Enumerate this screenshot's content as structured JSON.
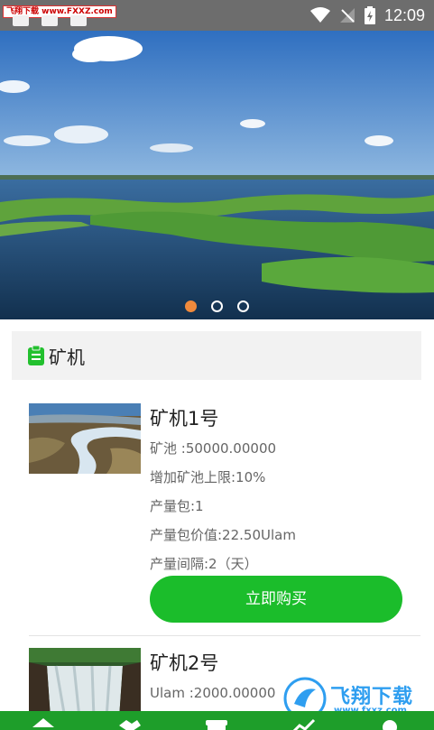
{
  "status_bar": {
    "watermark_top": "飞翔下载 www.FXXZ.com",
    "time": "12:09"
  },
  "banner": {
    "slide_count": 3,
    "active_index": 0
  },
  "section": {
    "title": "矿机",
    "icon": "clipboard-icon"
  },
  "products": [
    {
      "name": "矿机1号",
      "lines": [
        "矿池 :50000.00000",
        "增加矿池上限:10%",
        "产量包:1",
        "产量包价值:22.50Ulam",
        "产量间隔:2（天）"
      ],
      "buy_label": "立即购买"
    },
    {
      "name": "矿机2号",
      "lines": [
        "Ulam :2000.00000"
      ]
    }
  ],
  "watermark": {
    "text": "飞翔下载",
    "url": "www.fxxz.com"
  },
  "colors": {
    "accent": "#1bbd2b",
    "dot_active": "#f08a3c",
    "nav_bg": "#1e9e2a"
  }
}
